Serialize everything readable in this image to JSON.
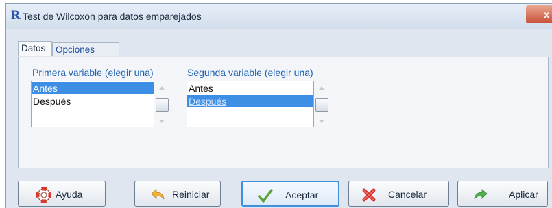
{
  "window": {
    "title": "Test de Wilcoxon para datos emparejados",
    "close_label": "x"
  },
  "tabs": [
    {
      "label": "Datos",
      "active": true
    },
    {
      "label": "Opciones",
      "active": false
    }
  ],
  "first_variable": {
    "label": "Primera variable (elegir una)",
    "items": [
      "Antes",
      "Después"
    ],
    "selected": "Antes"
  },
  "second_variable": {
    "label": "Segunda variable (elegir una)",
    "items": [
      "Antes",
      "Después"
    ],
    "selected": "Después"
  },
  "buttons": {
    "help": "Ayuda",
    "reset": "Reiniciar",
    "ok": "Aceptar",
    "cancel": "Cancelar",
    "apply": "Aplicar"
  },
  "icons": {
    "app": "r-logo-icon",
    "help": "lifebuoy-icon",
    "reset": "back-arrow-icon",
    "ok": "checkmark-icon",
    "cancel": "red-x-icon",
    "apply": "green-forward-arrow-icon"
  },
  "colors": {
    "accent": "#3d8fe6",
    "label_blue": "#1f63b5",
    "window_bg": "#dfe6ef",
    "close_red": "#c9513a"
  }
}
